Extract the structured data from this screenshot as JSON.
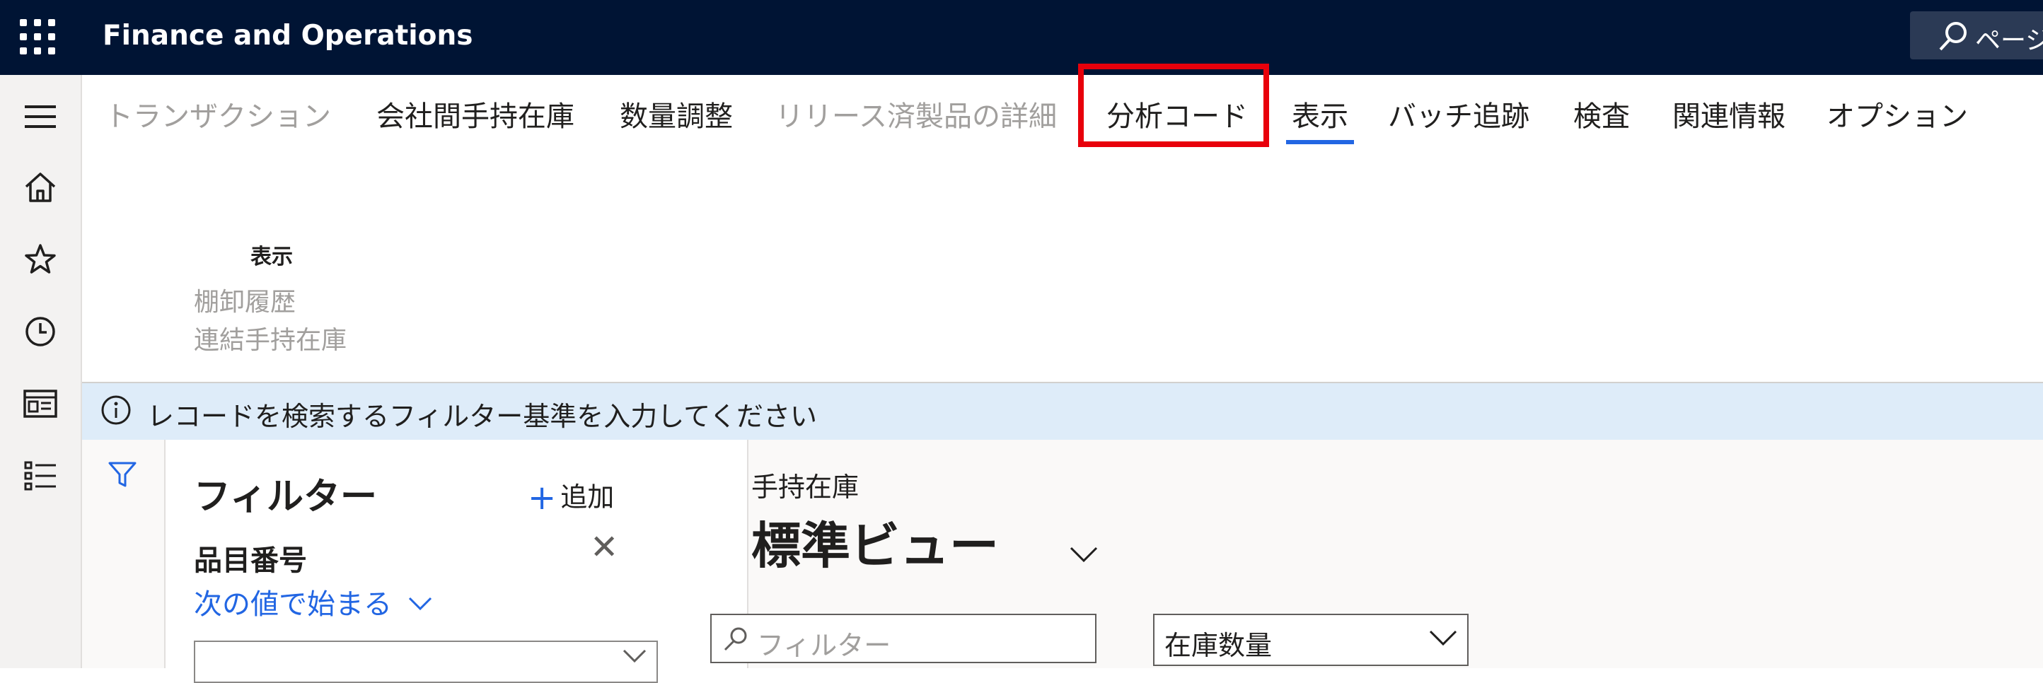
{
  "app": {
    "title": "Finance and Operations",
    "search_text": "ページ"
  },
  "nav": {
    "icons": [
      "menu-icon",
      "home-icon",
      "star-icon",
      "clock-icon",
      "workspace-icon",
      "list-icon"
    ]
  },
  "action_pane": {
    "tabs": [
      {
        "label": "トランザクション",
        "state": "disabled"
      },
      {
        "label": "会社間手持在庫",
        "state": "enabled"
      },
      {
        "label": "数量調整",
        "state": "enabled"
      },
      {
        "label": "リリース済製品の詳細",
        "state": "disabled"
      },
      {
        "label": "分析コード",
        "state": "enabled",
        "highlighted": true
      },
      {
        "label": "表示",
        "state": "selected"
      },
      {
        "label": "バッチ追跡",
        "state": "enabled"
      },
      {
        "label": "検査",
        "state": "enabled"
      },
      {
        "label": "関連情報",
        "state": "enabled"
      },
      {
        "label": "オプション",
        "state": "enabled"
      }
    ],
    "group": {
      "label": "表示",
      "items": [
        "棚卸履歴",
        "連結手持在庫"
      ]
    },
    "highlight_color": "#e8000b"
  },
  "infobar": {
    "text": "レコードを検索するフィルター基準を入力してください"
  },
  "filter_pane": {
    "title": "フィルター",
    "add_label": "追加",
    "field_label": "品目番号",
    "operator": "次の値で始まる"
  },
  "main": {
    "subtitle": "手持在庫",
    "view_title": "標準ビュー",
    "grid_filter_placeholder": "フィルター",
    "quantity_select_value": "在庫数量"
  },
  "colors": {
    "topbar": "#001434",
    "accent": "#2266e3",
    "infobar": "#deecf9"
  }
}
